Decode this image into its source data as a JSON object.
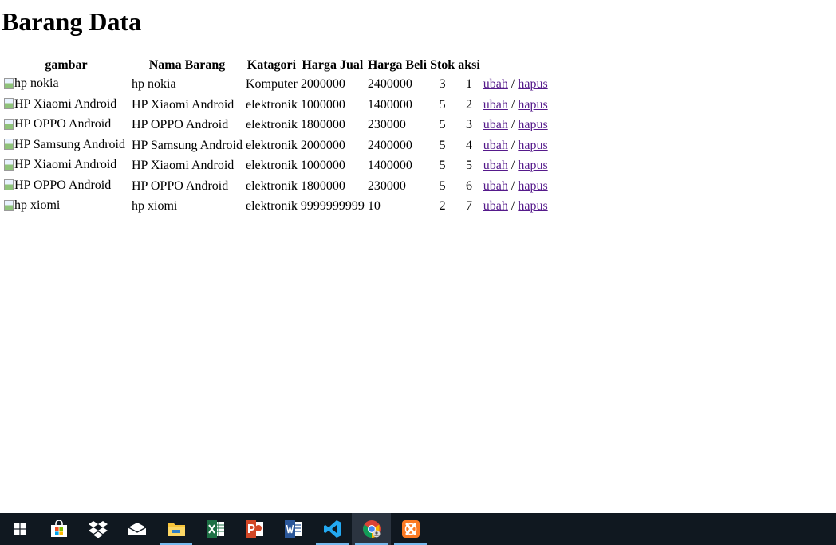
{
  "page": {
    "title": "Barang Data"
  },
  "table": {
    "headers": [
      "gambar",
      "Nama Barang",
      "Katagori",
      "Harga Jual",
      "Harga Beli",
      "Stok",
      "aksi"
    ],
    "rows": [
      {
        "img_alt": "hp nokia",
        "nama": "hp nokia",
        "kategori": "Komputer",
        "jual": "2000000",
        "beli": "2400000",
        "stok": "3",
        "id": "1"
      },
      {
        "img_alt": "HP Xiaomi Android",
        "nama": "HP Xiaomi Android",
        "kategori": "elektronik",
        "jual": "1000000",
        "beli": "1400000",
        "stok": "5",
        "id": "2"
      },
      {
        "img_alt": "HP OPPO Android",
        "nama": "HP OPPO Android",
        "kategori": "elektronik",
        "jual": "1800000",
        "beli": "230000",
        "stok": "5",
        "id": "3"
      },
      {
        "img_alt": "HP Samsung Android",
        "nama": "HP Samsung Android",
        "kategori": "elektronik",
        "jual": "2000000",
        "beli": "2400000",
        "stok": "5",
        "id": "4"
      },
      {
        "img_alt": "HP Xiaomi Android",
        "nama": "HP Xiaomi Android",
        "kategori": "elektronik",
        "jual": "1000000",
        "beli": "1400000",
        "stok": "5",
        "id": "5"
      },
      {
        "img_alt": "HP OPPO Android",
        "nama": "HP OPPO Android",
        "kategori": "elektronik",
        "jual": "1800000",
        "beli": "230000",
        "stok": "5",
        "id": "6"
      },
      {
        "img_alt": "hp xiomi",
        "nama": "hp xiomi",
        "kategori": "elektronik",
        "jual": "9999999999",
        "beli": "10",
        "stok": "2",
        "id": "7"
      }
    ],
    "actions": {
      "edit": "ubah",
      "separator": "/",
      "delete": "hapus"
    }
  },
  "taskbar": {
    "items": [
      {
        "icon": "windows-start-icon",
        "running": false,
        "active": false
      },
      {
        "icon": "microsoft-store-icon",
        "running": false,
        "active": false
      },
      {
        "icon": "dropbox-icon",
        "running": false,
        "active": false
      },
      {
        "icon": "mail-icon",
        "running": false,
        "active": false
      },
      {
        "icon": "file-explorer-icon",
        "running": true,
        "active": false
      },
      {
        "icon": "excel-icon",
        "running": false,
        "active": false
      },
      {
        "icon": "powerpoint-icon",
        "running": false,
        "active": false
      },
      {
        "icon": "word-icon",
        "running": false,
        "active": false
      },
      {
        "icon": "vscode-icon",
        "running": true,
        "active": false
      },
      {
        "icon": "chrome-icon",
        "running": true,
        "active": true
      },
      {
        "icon": "xampp-icon",
        "running": true,
        "active": false
      }
    ]
  }
}
